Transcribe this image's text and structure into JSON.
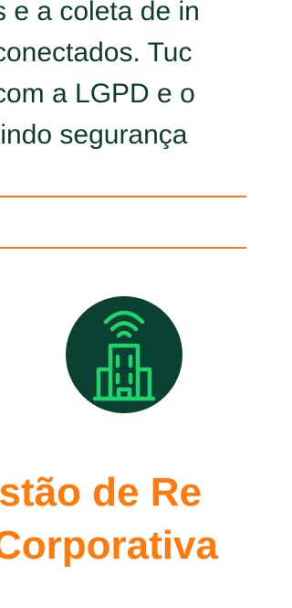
{
  "intro": {
    "lines": [
      "s e a coleta de in",
      "conectados. Tuc",
      "com a LGPD e o",
      "tindo segurança"
    ]
  },
  "feature": {
    "icon": "smart-building-icon",
    "title_lines": [
      "estão de Re",
      "Corporativa"
    ]
  },
  "colors": {
    "text": "#0d3b2e",
    "accent": "#ff7a0c",
    "divider": "#f07d1a",
    "icon_bg": "#0a4132",
    "icon_stroke": "#1fd36a"
  }
}
